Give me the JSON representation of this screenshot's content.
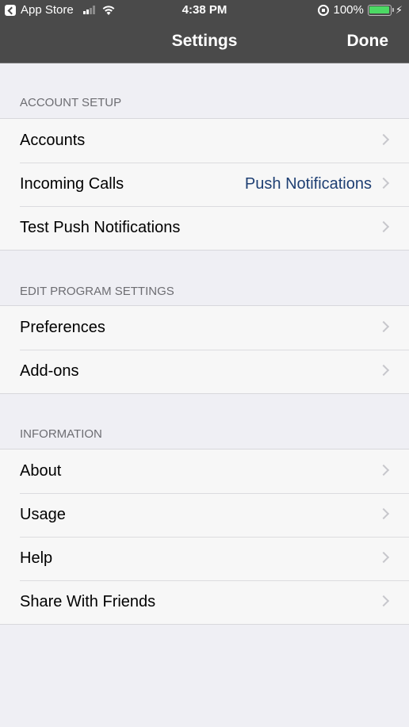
{
  "status_bar": {
    "back_app": "App Store",
    "time": "4:38 PM",
    "battery": "100%",
    "battery_level": 1.0,
    "signal_bars": 2,
    "icons": [
      "back-icon",
      "signal-icon",
      "wifi-icon",
      "rotation-lock-icon",
      "battery-icon",
      "charging-icon"
    ]
  },
  "navbar": {
    "title": "Settings",
    "done_label": "Done"
  },
  "sections": [
    {
      "header": "ACCOUNT SETUP",
      "items": [
        {
          "label": "Accounts"
        },
        {
          "label": "Incoming Calls",
          "value": "Push Notifications"
        },
        {
          "label": "Test Push Notifications"
        }
      ]
    },
    {
      "header": "EDIT PROGRAM SETTINGS",
      "items": [
        {
          "label": "Preferences"
        },
        {
          "label": "Add-ons"
        }
      ]
    },
    {
      "header": "INFORMATION",
      "items": [
        {
          "label": "About"
        },
        {
          "label": "Usage"
        },
        {
          "label": "Help"
        },
        {
          "label": "Share With Friends"
        }
      ]
    }
  ],
  "colors": {
    "bar_background": "#4a4a4a",
    "page_background": "#efeff4",
    "cell_background": "#f7f7f7",
    "detail_value": "#1e3f73",
    "battery_green": "#4cd964"
  }
}
